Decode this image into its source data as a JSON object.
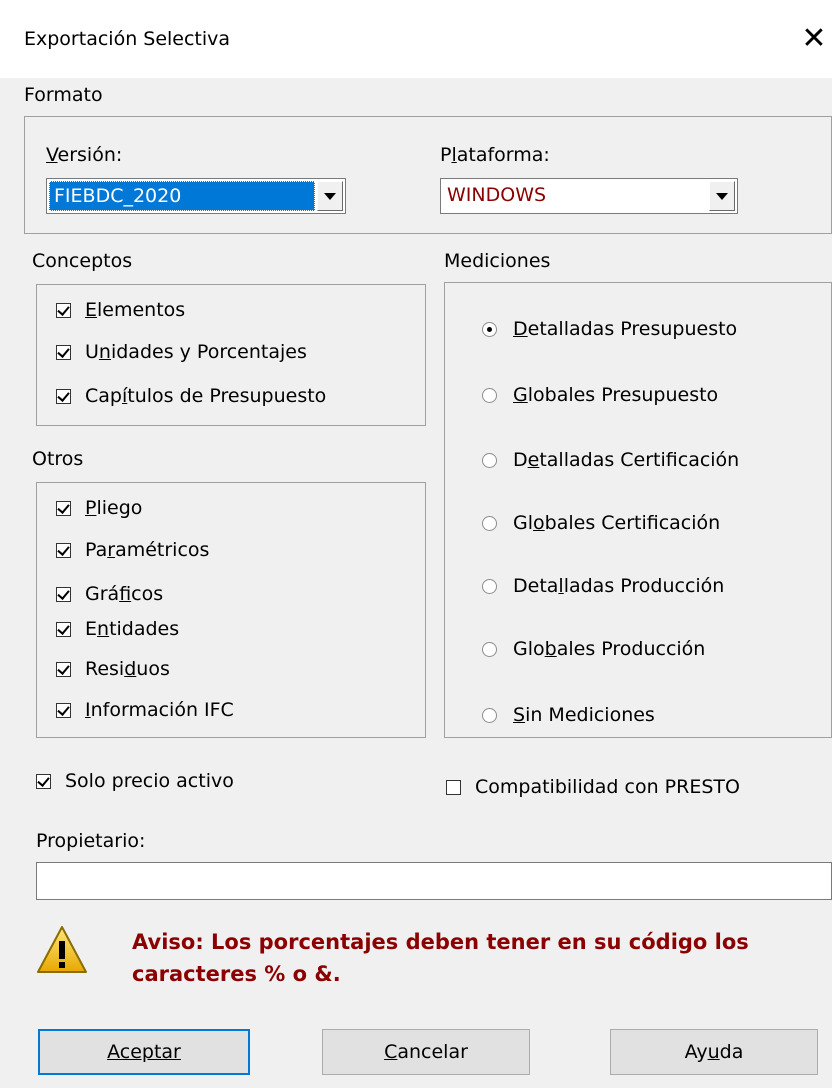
{
  "window": {
    "title": "Exportación Selectiva"
  },
  "formato": {
    "label": "Formato",
    "version": {
      "label": "Versión:",
      "value": "FIEBDC_2020"
    },
    "plataforma": {
      "label": "Plataforma:",
      "value": "WINDOWS"
    }
  },
  "conceptos": {
    "label": "Conceptos",
    "items": [
      {
        "label": "Elementos",
        "checked": true
      },
      {
        "label": "Unidades y Porcentajes",
        "checked": true
      },
      {
        "label": "Capítulos de Presupuesto",
        "checked": true
      }
    ]
  },
  "otros": {
    "label": "Otros",
    "items": [
      {
        "label": "Pliego",
        "checked": true
      },
      {
        "label": "Paramétricos",
        "checked": true
      },
      {
        "label": "Gráficos",
        "checked": true
      },
      {
        "label": "Entidades",
        "checked": true
      },
      {
        "label": "Residuos",
        "checked": true
      },
      {
        "label": "Información IFC",
        "checked": true
      }
    ]
  },
  "mediciones": {
    "label": "Mediciones",
    "options": [
      {
        "label": "Detalladas Presupuesto",
        "selected": true
      },
      {
        "label": "Globales Presupuesto",
        "selected": false
      },
      {
        "label": "Detalladas Certificación",
        "selected": false
      },
      {
        "label": "Globales Certificación",
        "selected": false
      },
      {
        "label": "Detalladas Producción",
        "selected": false
      },
      {
        "label": "Globales Producción",
        "selected": false
      },
      {
        "label": "Sin Mediciones",
        "selected": false
      }
    ]
  },
  "options": {
    "solo_precio_activo": {
      "label": "Solo precio activo",
      "checked": true
    },
    "compatibilidad_presto": {
      "label": "Compatibilidad con PRESTO",
      "checked": false
    }
  },
  "propietario": {
    "label": "Propietario:",
    "value": ""
  },
  "warning": {
    "line1": "Aviso: Los porcentajes deben tener en su código los",
    "line2": "caracteres % o &.",
    "color": "#8b0000"
  },
  "buttons": {
    "accept": "Aceptar",
    "cancel": "Cancelar",
    "help": "Ayuda"
  },
  "icons": {
    "close": "close-icon",
    "warning": "warning-icon"
  }
}
